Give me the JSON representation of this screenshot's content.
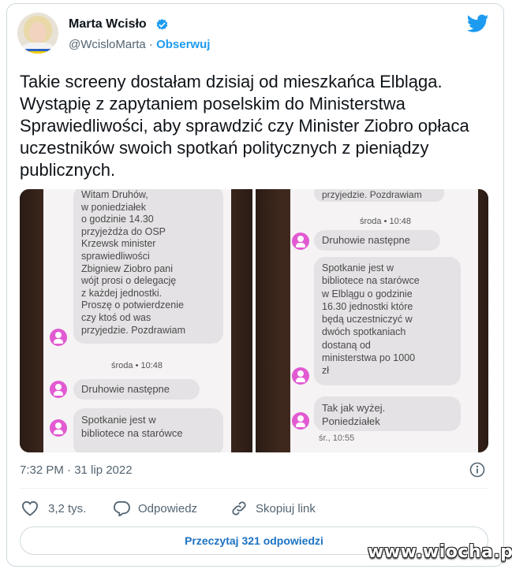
{
  "author": {
    "name": "Marta Wcisło",
    "handle": "@WcisloMarta",
    "separator": " · ",
    "follow_label": "Obserwuj"
  },
  "tweet_text": "Takie screeny dostałam dzisiaj od mieszkańca Elbląga.\nWystąpię z zapytaniem poselskim do Ministerstwa\nSprawiedliwości, aby sprawdzić czy Minister Ziobro opłaca\nuczestników swoich spotkań politycznych z pieniądzy\npublicznych.",
  "media": {
    "left": {
      "message1": "Witam Druhów,\nw poniedziałek\no godzinie 14.30\nprzyjeżdża do  OSP\nKrzewsk minister\nsprawiedliwości\nZbigniew Ziobro pani\nwójt prosi o delegację\nz każdej jednostki.\nProszę o potwierdzenie\nczy ktoś od was\nprzyjedzie. Pozdrawiam",
      "day_label": "środa • 10:48",
      "message2": "Druhowie następne",
      "message3": "Spotkanie jest w\nbibliotece na starówce"
    },
    "right": {
      "message1": "przyjedzie. Pozdrawiam",
      "day_label": "środa • 10:48",
      "message2": "Druhowie następne",
      "message3": "Spotkanie jest w\nbibliotece na starówce\nw Elblągu o godzinie\n16.30 jednostki które\nbędą uczestniczyć w\ndwóch spotkaniach\ndostaną od\nministerstwa po 1000\nzł",
      "message4": "Tak jak wyżej.\nPoniedziałek",
      "time_label": "śr., 10:55"
    }
  },
  "timestamp": "7:32 PM · 31 lip 2022",
  "actions": {
    "likes": "3,2 tys.",
    "reply": "Odpowiedz",
    "copy_link": "Skopiuj link"
  },
  "read_replies": "Przeczytaj 321 odpowiedzi",
  "watermark": "www.wiocha.pl",
  "colors": {
    "accent": "#1d9bf0",
    "link": "#1d72c2",
    "secondary_text": "#536471",
    "pin": "#e25ad2"
  }
}
